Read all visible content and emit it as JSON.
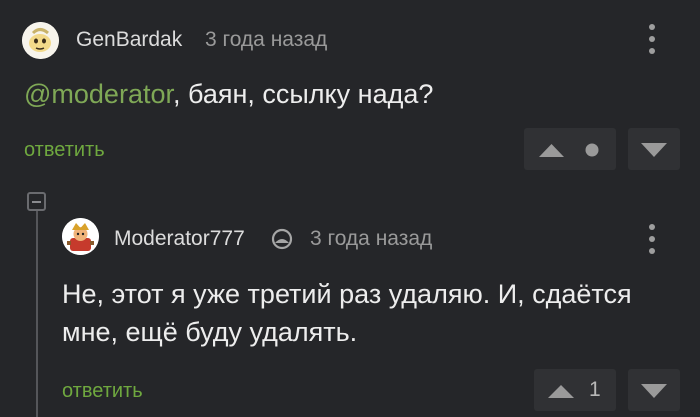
{
  "comments": [
    {
      "author": "GenBardak",
      "time": "3 года назад",
      "mention": "@moderator",
      "text": ", баян, ссылку нада?",
      "reply_label": "ответить",
      "score": ""
    },
    {
      "author": "Moderator777",
      "time": "3 года назад",
      "text_line1": "Не, этот я уже третий раз удаляю. И, сдаётся",
      "text_line2": "мне, ещё буду удалять.",
      "reply_label": "ответить",
      "score": "1"
    }
  ],
  "colors": {
    "background": "#252629",
    "accent_green": "#6fa83f",
    "mention_green": "#7fa856",
    "vote_box": "#303134"
  },
  "icons": {
    "moderator_badge": "moderator-shield-icon",
    "menu": "more-vertical-icon",
    "vote_up": "triangle-up-icon",
    "vote_down": "triangle-down-icon",
    "collapse": "collapse-minus-icon"
  }
}
